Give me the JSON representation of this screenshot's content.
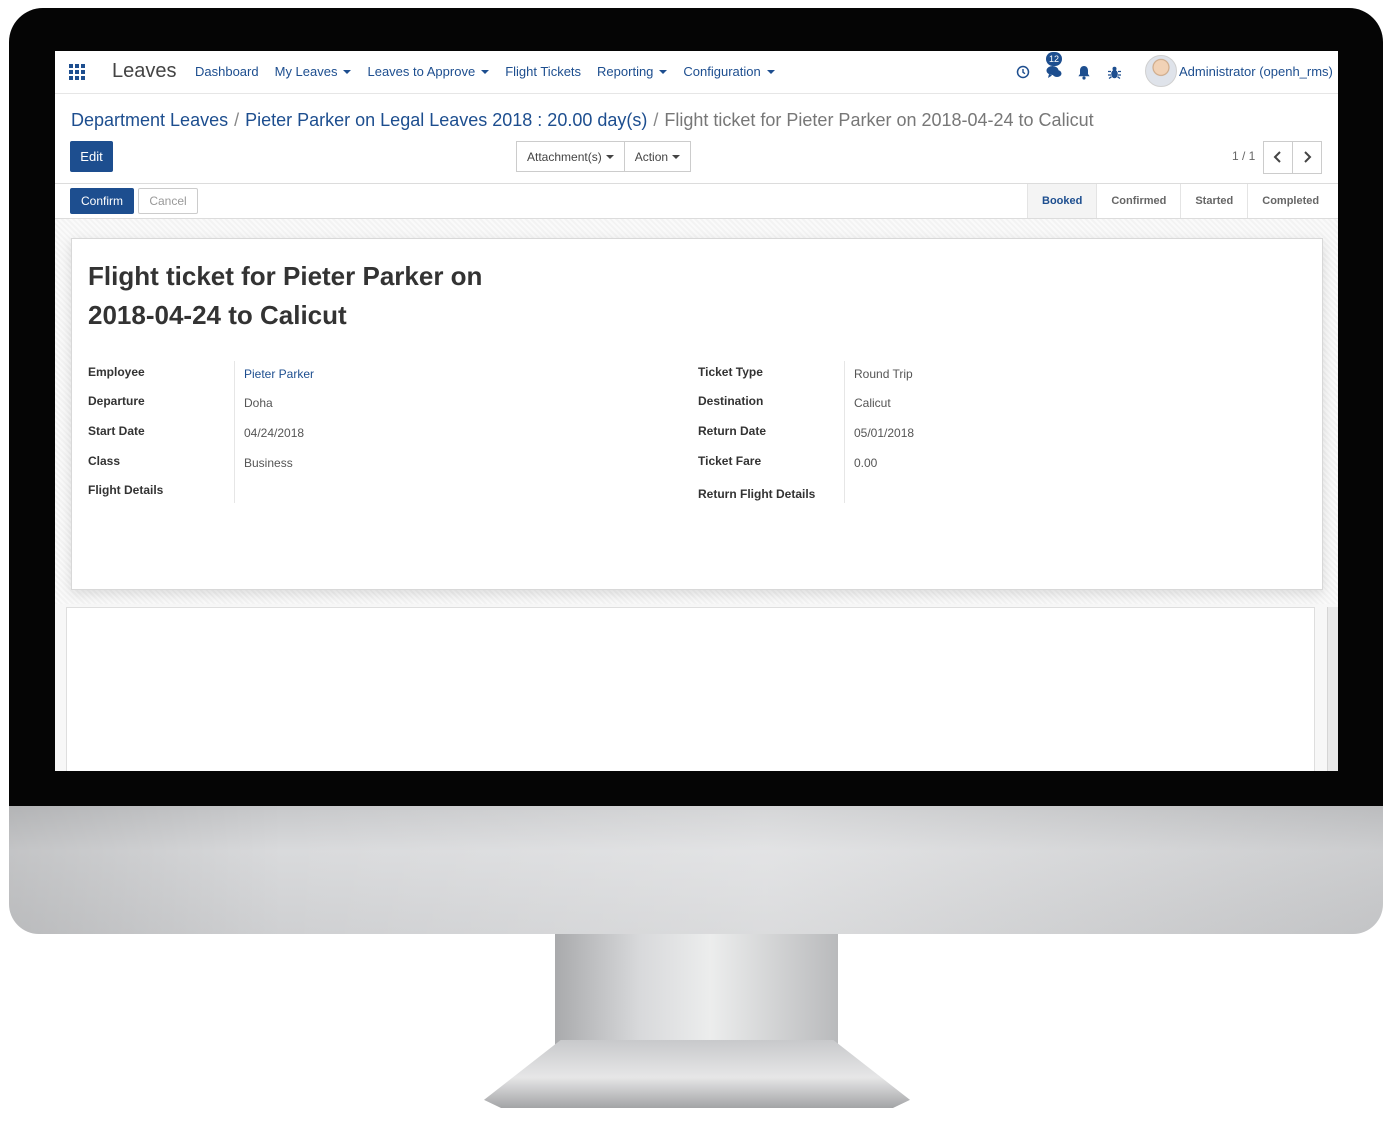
{
  "app": {
    "name": "Leaves"
  },
  "menu": [
    {
      "label": "Dashboard",
      "dropdown": false
    },
    {
      "label": "My Leaves",
      "dropdown": true
    },
    {
      "label": "Leaves to Approve",
      "dropdown": true
    },
    {
      "label": "Flight Tickets",
      "dropdown": false
    },
    {
      "label": "Reporting",
      "dropdown": true
    },
    {
      "label": "Configuration",
      "dropdown": true
    }
  ],
  "systray": {
    "messages_count": "12",
    "user": "Administrator (openh_rms)",
    "icons": [
      "clock-icon",
      "chat-icon",
      "bell-icon",
      "bug-icon"
    ]
  },
  "breadcrumb": {
    "item1": "Department Leaves",
    "item2": "Pieter Parker on Legal Leaves 2018 : 20.00 day(s)",
    "current": "Flight ticket for Pieter Parker on 2018-04-24 to Calicut",
    "sep": "/"
  },
  "buttons": {
    "edit": "Edit",
    "attachments": "Attachment(s)",
    "action": "Action",
    "confirm": "Confirm",
    "cancel": "Cancel"
  },
  "pager": {
    "value": "1 / 1"
  },
  "stages": [
    "Booked",
    "Confirmed",
    "Started",
    "Completed"
  ],
  "active_stage": "Booked",
  "form": {
    "title": "Flight ticket for Pieter Parker on 2018-04-24 to Calicut",
    "left": {
      "employee_label": "Employee",
      "employee": "Pieter Parker",
      "departure_label": "Departure",
      "departure": "Doha",
      "start_date_label": "Start Date",
      "start_date": "04/24/2018",
      "class_label": "Class",
      "class": "Business",
      "flight_details_label": "Flight Details"
    },
    "right": {
      "ticket_type_label": "Ticket Type",
      "ticket_type": "Round Trip",
      "destination_label": "Destination",
      "destination": "Calicut",
      "return_date_label": "Return Date",
      "return_date": "05/01/2018",
      "ticket_fare_label": "Ticket Fare",
      "ticket_fare": "0.00",
      "return_flight_details_label": "Return Flight Details"
    }
  },
  "colors": {
    "brand": "#1d4e8f",
    "bezel": "#050505"
  }
}
